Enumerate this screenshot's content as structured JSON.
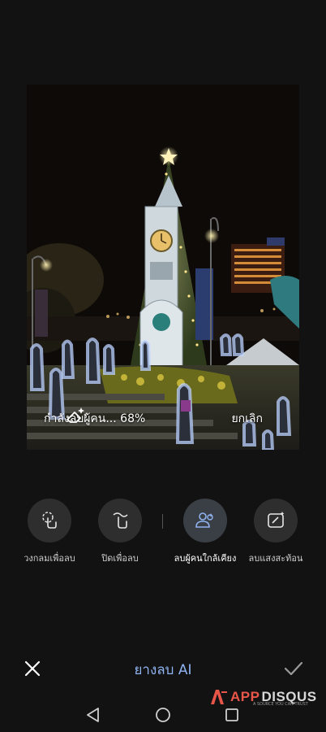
{
  "photo": {
    "description_icon": "ai-sparkle-eraser-icon"
  },
  "progress": {
    "text": "กำลังลบผู้คน... 68%",
    "value_percent": 68,
    "cancel_label": "ยกเลิก"
  },
  "tools": [
    {
      "label": "วงกลมเพื่อลบ",
      "icon": "circle-finger-icon",
      "active": false
    },
    {
      "label": "ปิดเพื่อลบ",
      "icon": "brush-finger-icon",
      "active": false
    },
    {
      "label": "ลบผู้คนใกล้เคียง",
      "icon": "people-remove-icon",
      "active": true
    },
    {
      "label": "ลบแสงสะท้อน",
      "icon": "reflection-remove-icon",
      "active": false
    }
  ],
  "bottom": {
    "title": "ยางลบ AI",
    "close_icon": "close-icon",
    "confirm_icon": "check-icon"
  },
  "watermark": {
    "brand_part1": "APP",
    "brand_part2": "DISQUS",
    "tagline": "A SOURCE YOU CAN TRUST"
  },
  "colors": {
    "accent": "#8fb3f0",
    "background": "#121212",
    "brand": "#e8564a"
  }
}
